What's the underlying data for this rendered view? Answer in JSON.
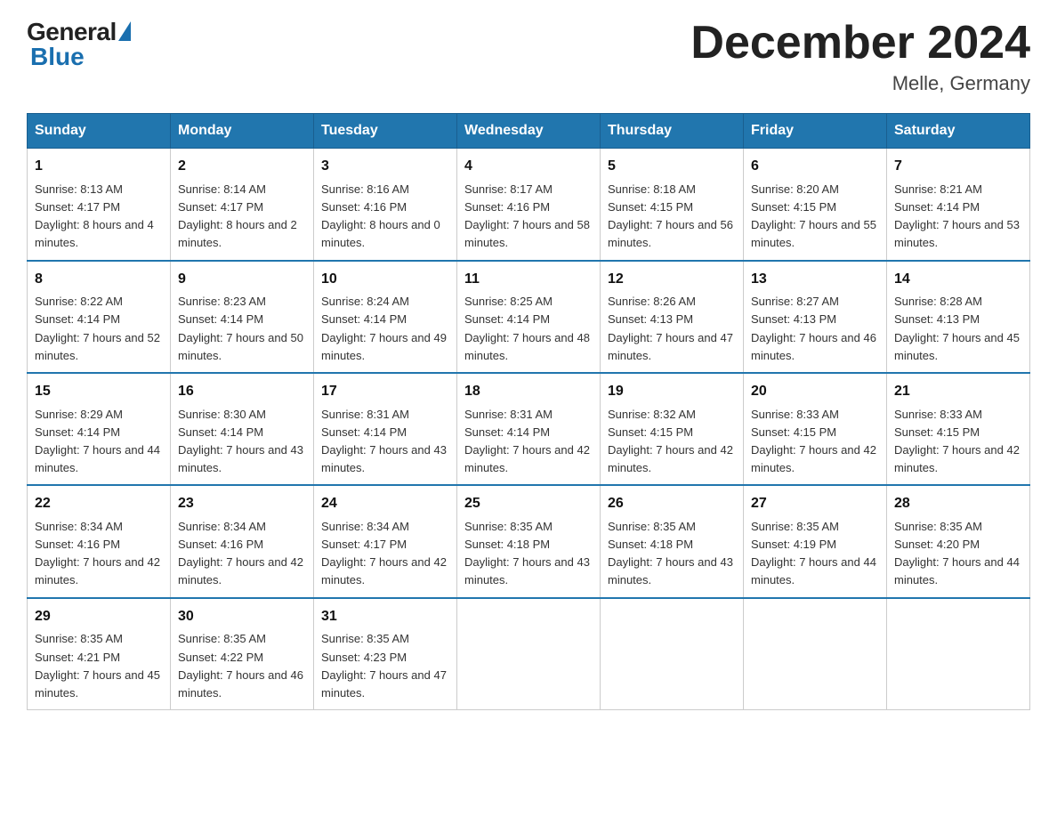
{
  "header": {
    "logo_general": "General",
    "logo_blue": "Blue",
    "month_title": "December 2024",
    "location": "Melle, Germany"
  },
  "days_of_week": [
    "Sunday",
    "Monday",
    "Tuesday",
    "Wednesday",
    "Thursday",
    "Friday",
    "Saturday"
  ],
  "weeks": [
    [
      {
        "day": "1",
        "sunrise": "Sunrise: 8:13 AM",
        "sunset": "Sunset: 4:17 PM",
        "daylight": "Daylight: 8 hours and 4 minutes."
      },
      {
        "day": "2",
        "sunrise": "Sunrise: 8:14 AM",
        "sunset": "Sunset: 4:17 PM",
        "daylight": "Daylight: 8 hours and 2 minutes."
      },
      {
        "day": "3",
        "sunrise": "Sunrise: 8:16 AM",
        "sunset": "Sunset: 4:16 PM",
        "daylight": "Daylight: 8 hours and 0 minutes."
      },
      {
        "day": "4",
        "sunrise": "Sunrise: 8:17 AM",
        "sunset": "Sunset: 4:16 PM",
        "daylight": "Daylight: 7 hours and 58 minutes."
      },
      {
        "day": "5",
        "sunrise": "Sunrise: 8:18 AM",
        "sunset": "Sunset: 4:15 PM",
        "daylight": "Daylight: 7 hours and 56 minutes."
      },
      {
        "day": "6",
        "sunrise": "Sunrise: 8:20 AM",
        "sunset": "Sunset: 4:15 PM",
        "daylight": "Daylight: 7 hours and 55 minutes."
      },
      {
        "day": "7",
        "sunrise": "Sunrise: 8:21 AM",
        "sunset": "Sunset: 4:14 PM",
        "daylight": "Daylight: 7 hours and 53 minutes."
      }
    ],
    [
      {
        "day": "8",
        "sunrise": "Sunrise: 8:22 AM",
        "sunset": "Sunset: 4:14 PM",
        "daylight": "Daylight: 7 hours and 52 minutes."
      },
      {
        "day": "9",
        "sunrise": "Sunrise: 8:23 AM",
        "sunset": "Sunset: 4:14 PM",
        "daylight": "Daylight: 7 hours and 50 minutes."
      },
      {
        "day": "10",
        "sunrise": "Sunrise: 8:24 AM",
        "sunset": "Sunset: 4:14 PM",
        "daylight": "Daylight: 7 hours and 49 minutes."
      },
      {
        "day": "11",
        "sunrise": "Sunrise: 8:25 AM",
        "sunset": "Sunset: 4:14 PM",
        "daylight": "Daylight: 7 hours and 48 minutes."
      },
      {
        "day": "12",
        "sunrise": "Sunrise: 8:26 AM",
        "sunset": "Sunset: 4:13 PM",
        "daylight": "Daylight: 7 hours and 47 minutes."
      },
      {
        "day": "13",
        "sunrise": "Sunrise: 8:27 AM",
        "sunset": "Sunset: 4:13 PM",
        "daylight": "Daylight: 7 hours and 46 minutes."
      },
      {
        "day": "14",
        "sunrise": "Sunrise: 8:28 AM",
        "sunset": "Sunset: 4:13 PM",
        "daylight": "Daylight: 7 hours and 45 minutes."
      }
    ],
    [
      {
        "day": "15",
        "sunrise": "Sunrise: 8:29 AM",
        "sunset": "Sunset: 4:14 PM",
        "daylight": "Daylight: 7 hours and 44 minutes."
      },
      {
        "day": "16",
        "sunrise": "Sunrise: 8:30 AM",
        "sunset": "Sunset: 4:14 PM",
        "daylight": "Daylight: 7 hours and 43 minutes."
      },
      {
        "day": "17",
        "sunrise": "Sunrise: 8:31 AM",
        "sunset": "Sunset: 4:14 PM",
        "daylight": "Daylight: 7 hours and 43 minutes."
      },
      {
        "day": "18",
        "sunrise": "Sunrise: 8:31 AM",
        "sunset": "Sunset: 4:14 PM",
        "daylight": "Daylight: 7 hours and 42 minutes."
      },
      {
        "day": "19",
        "sunrise": "Sunrise: 8:32 AM",
        "sunset": "Sunset: 4:15 PM",
        "daylight": "Daylight: 7 hours and 42 minutes."
      },
      {
        "day": "20",
        "sunrise": "Sunrise: 8:33 AM",
        "sunset": "Sunset: 4:15 PM",
        "daylight": "Daylight: 7 hours and 42 minutes."
      },
      {
        "day": "21",
        "sunrise": "Sunrise: 8:33 AM",
        "sunset": "Sunset: 4:15 PM",
        "daylight": "Daylight: 7 hours and 42 minutes."
      }
    ],
    [
      {
        "day": "22",
        "sunrise": "Sunrise: 8:34 AM",
        "sunset": "Sunset: 4:16 PM",
        "daylight": "Daylight: 7 hours and 42 minutes."
      },
      {
        "day": "23",
        "sunrise": "Sunrise: 8:34 AM",
        "sunset": "Sunset: 4:16 PM",
        "daylight": "Daylight: 7 hours and 42 minutes."
      },
      {
        "day": "24",
        "sunrise": "Sunrise: 8:34 AM",
        "sunset": "Sunset: 4:17 PM",
        "daylight": "Daylight: 7 hours and 42 minutes."
      },
      {
        "day": "25",
        "sunrise": "Sunrise: 8:35 AM",
        "sunset": "Sunset: 4:18 PM",
        "daylight": "Daylight: 7 hours and 43 minutes."
      },
      {
        "day": "26",
        "sunrise": "Sunrise: 8:35 AM",
        "sunset": "Sunset: 4:18 PM",
        "daylight": "Daylight: 7 hours and 43 minutes."
      },
      {
        "day": "27",
        "sunrise": "Sunrise: 8:35 AM",
        "sunset": "Sunset: 4:19 PM",
        "daylight": "Daylight: 7 hours and 44 minutes."
      },
      {
        "day": "28",
        "sunrise": "Sunrise: 8:35 AM",
        "sunset": "Sunset: 4:20 PM",
        "daylight": "Daylight: 7 hours and 44 minutes."
      }
    ],
    [
      {
        "day": "29",
        "sunrise": "Sunrise: 8:35 AM",
        "sunset": "Sunset: 4:21 PM",
        "daylight": "Daylight: 7 hours and 45 minutes."
      },
      {
        "day": "30",
        "sunrise": "Sunrise: 8:35 AM",
        "sunset": "Sunset: 4:22 PM",
        "daylight": "Daylight: 7 hours and 46 minutes."
      },
      {
        "day": "31",
        "sunrise": "Sunrise: 8:35 AM",
        "sunset": "Sunset: 4:23 PM",
        "daylight": "Daylight: 7 hours and 47 minutes."
      },
      null,
      null,
      null,
      null
    ]
  ]
}
